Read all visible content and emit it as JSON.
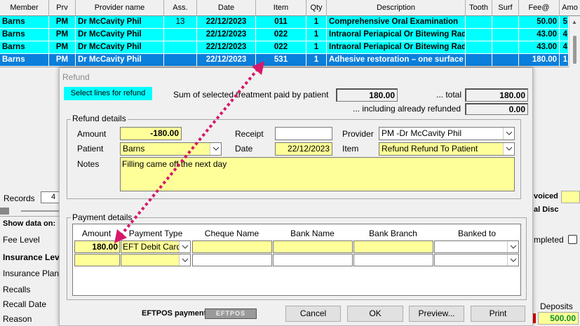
{
  "grid": {
    "columns": [
      "Member",
      "Prv",
      "Provider name",
      "Ass.",
      "Date",
      "Item",
      "Qty",
      "Description",
      "Tooth",
      "Surf",
      "Fee@",
      "Amo"
    ],
    "rows": [
      {
        "member": "Barns",
        "prv": "PM",
        "provider": "Dr McCavity Phil",
        "ass": "13",
        "date": "22/12/2023",
        "item": "011",
        "qty": "1",
        "description": "Comprehensive Oral Examination",
        "tooth": "",
        "surf": "",
        "fee": "50.00",
        "amount": "5"
      },
      {
        "member": "Barns",
        "prv": "PM",
        "provider": "Dr McCavity Phil",
        "ass": "",
        "date": "22/12/2023",
        "item": "022",
        "qty": "1",
        "description": "Intraoral Periapical Or Bitewing Radi",
        "tooth": "",
        "surf": "",
        "fee": "43.00",
        "amount": "4"
      },
      {
        "member": "Barns",
        "prv": "PM",
        "provider": "Dr McCavity Phil",
        "ass": "",
        "date": "22/12/2023",
        "item": "022",
        "qty": "1",
        "description": "Intraoral Periapical Or Bitewing Radi",
        "tooth": "",
        "surf": "",
        "fee": "43.00",
        "amount": "4"
      },
      {
        "member": "Barns",
        "prv": "PM",
        "provider": "Dr McCavity Phil",
        "ass": "",
        "date": "22/12/2023",
        "item": "531",
        "qty": "1",
        "description": "Adhesive restoration – one surface",
        "tooth": "",
        "surf": "",
        "fee": "180.00",
        "amount": "1"
      }
    ]
  },
  "background": {
    "records_label": "Records",
    "records_value": "4",
    "show_data_on": "Show data on:",
    "fee_level": "Fee Level",
    "insurance_level": "Insurance Leve",
    "insurance_plan": "Insurance Plan",
    "recalls": "Recalls",
    "recall_date": "Recall Date",
    "reason": "Reason",
    "invoiced": "voiced",
    "total_disc": "al Disc",
    "completed": "mpleted",
    "deposits": "Deposits",
    "deposits_value": "500.00"
  },
  "dialog": {
    "title": "Refund",
    "hint": "Select lines for refund",
    "sum_label": "Sum of selected treatment paid by patient",
    "sum_value": "180.00",
    "total_label": "... total",
    "total_value": "180.00",
    "already_label": "... including already refunded",
    "already_value": "0.00",
    "refund_details": {
      "title": "Refund details",
      "amount_label": "Amount",
      "amount_value": "-180.00",
      "receipt_label": "Receipt",
      "receipt_value": "",
      "provider_label": "Provider",
      "provider_value": "PM -Dr McCavity Phil",
      "patient_label": "Patient",
      "patient_value": "Barns",
      "date_label": "Date",
      "date_value": "22/12/2023",
      "item_label": "Item",
      "item_value": "Refund Refund To Patient",
      "notes_label": "Notes",
      "notes_value": "Filling came off the next day"
    },
    "payment_details": {
      "title": "Payment details",
      "headers": [
        "Amount",
        "Payment Type",
        "Cheque Name",
        "Bank Name",
        "Bank Branch",
        "Banked to"
      ],
      "rows": [
        {
          "amount": "180.00",
          "payment_type": "EFT Debit Card",
          "cheque_name": "",
          "bank_name": "",
          "bank_branch": "",
          "banked_to": ""
        },
        {
          "amount": "",
          "payment_type": "",
          "cheque_name": "",
          "bank_name": "",
          "bank_branch": "",
          "banked_to": ""
        }
      ]
    },
    "eftpos_label": "EFTPOS payment",
    "eftpos_button": "EFTPOS",
    "buttons": {
      "cancel": "Cancel",
      "ok": "OK",
      "preview": "Preview...",
      "print": "Print"
    }
  },
  "colors": {
    "highlight": "#00ffff",
    "selected": "#0a7fdc",
    "input_yellow": "#ffff99",
    "annotation_arrow": "#d6186a"
  }
}
